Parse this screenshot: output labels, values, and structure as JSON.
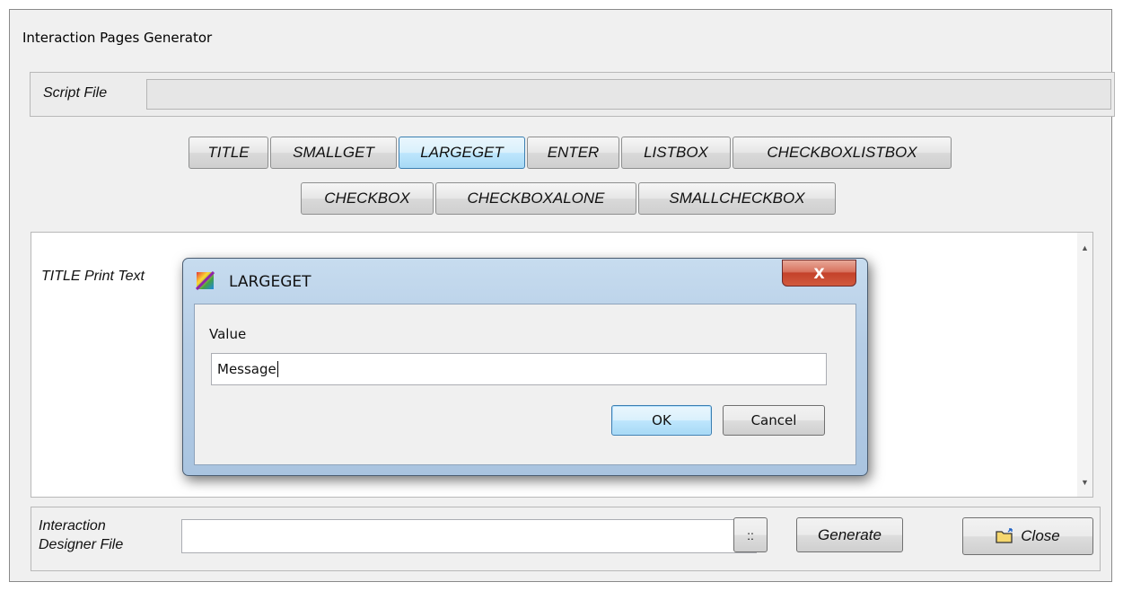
{
  "window": {
    "title": "Interaction Pages Generator"
  },
  "script_file": {
    "label": "Script File",
    "value": ""
  },
  "toolbar": {
    "buttons": [
      "TITLE",
      "SMALLGET",
      "LARGEGET",
      "ENTER",
      "LISTBOX",
      "CHECKBOXLISTBOX",
      "CHECKBOX",
      "CHECKBOXALONE",
      "SMALLCHECKBOX"
    ],
    "active": "LARGEGET"
  },
  "content": {
    "print_label": "TITLE Print Text"
  },
  "bottom": {
    "label_line1": "Interaction",
    "label_line2": "Designer File",
    "field_value": "",
    "browse_label": "::",
    "generate_label": "Generate",
    "close_label": "Close",
    "close_icon": "folder-open-icon"
  },
  "dialog": {
    "title": "LARGEGET",
    "close_glyph": "X",
    "value_label": "Value",
    "value": "Message",
    "ok_label": "OK",
    "cancel_label": "Cancel"
  }
}
